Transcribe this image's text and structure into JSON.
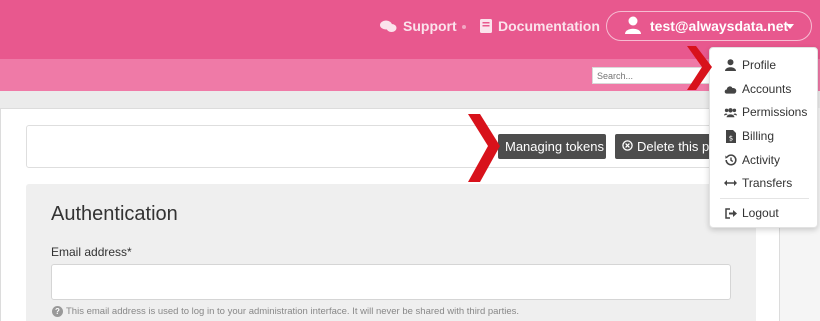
{
  "header": {
    "support_label": "Support",
    "documentation_label": "Documentation",
    "account_email": "test@alwaysdata.net",
    "brand_color": "#e8588e"
  },
  "subbar": {
    "search_placeholder": "Search..."
  },
  "toolbar": {
    "managing_tokens_label": "Managing tokens",
    "delete_label": "Delete this pr"
  },
  "form": {
    "section_title": "Authentication",
    "email_label": "Email address*",
    "email_value": "",
    "email_help": "This email address is used to log in to your administration interface. It will never be shared with third parties."
  },
  "account_menu": {
    "items": [
      {
        "label": "Profile",
        "icon": "user-icon"
      },
      {
        "label": "Accounts",
        "icon": "cloud-icon"
      },
      {
        "label": "Permissions",
        "icon": "users-icon"
      },
      {
        "label": "Billing",
        "icon": "invoice-icon"
      },
      {
        "label": "Activity",
        "icon": "history-icon"
      },
      {
        "label": "Transfers",
        "icon": "arrows-horizontal-icon"
      }
    ],
    "logout_label": "Logout"
  },
  "annotation_color": "#d8121b"
}
